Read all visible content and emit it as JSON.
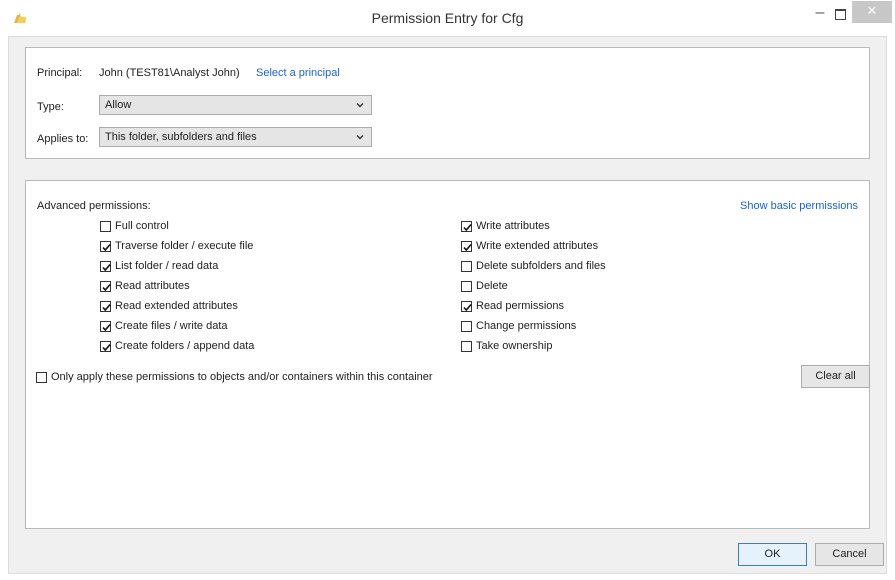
{
  "window": {
    "title": "Permission Entry for Cfg",
    "close_glyph": "✕",
    "minimize_glyph": "–"
  },
  "principal": {
    "label": "Principal:",
    "value": "John (TEST81\\Analyst John)",
    "select_link": "Select a principal"
  },
  "type": {
    "label": "Type:",
    "value": "Allow"
  },
  "applies_to": {
    "label": "Applies to:",
    "value": "This folder, subfolders and files"
  },
  "advanced": {
    "heading": "Advanced permissions:",
    "show_basic_link": "Show basic permissions",
    "left": [
      {
        "label": "Full control",
        "checked": false
      },
      {
        "label": "Traverse folder / execute file",
        "checked": true
      },
      {
        "label": "List folder / read data",
        "checked": true
      },
      {
        "label": "Read attributes",
        "checked": true
      },
      {
        "label": "Read extended attributes",
        "checked": true
      },
      {
        "label": "Create files / write data",
        "checked": true
      },
      {
        "label": "Create folders / append data",
        "checked": true
      }
    ],
    "right": [
      {
        "label": "Write attributes",
        "checked": true
      },
      {
        "label": "Write extended attributes",
        "checked": true
      },
      {
        "label": "Delete subfolders and files",
        "checked": false
      },
      {
        "label": "Delete",
        "checked": false
      },
      {
        "label": "Read permissions",
        "checked": true
      },
      {
        "label": "Change permissions",
        "checked": false
      },
      {
        "label": "Take ownership",
        "checked": false
      }
    ],
    "only_apply": {
      "label": "Only apply these permissions to objects and/or containers within this container",
      "checked": false
    },
    "clear_all": "Clear all"
  },
  "footer": {
    "ok": "OK",
    "cancel": "Cancel"
  },
  "colors": {
    "link": "#1a64c8",
    "background": "#f0f0f0",
    "close_button": "#c7c7c7"
  },
  "icons": {
    "app": "folder-icon",
    "dropdown": "chevron-down-icon",
    "check": "check-icon"
  }
}
